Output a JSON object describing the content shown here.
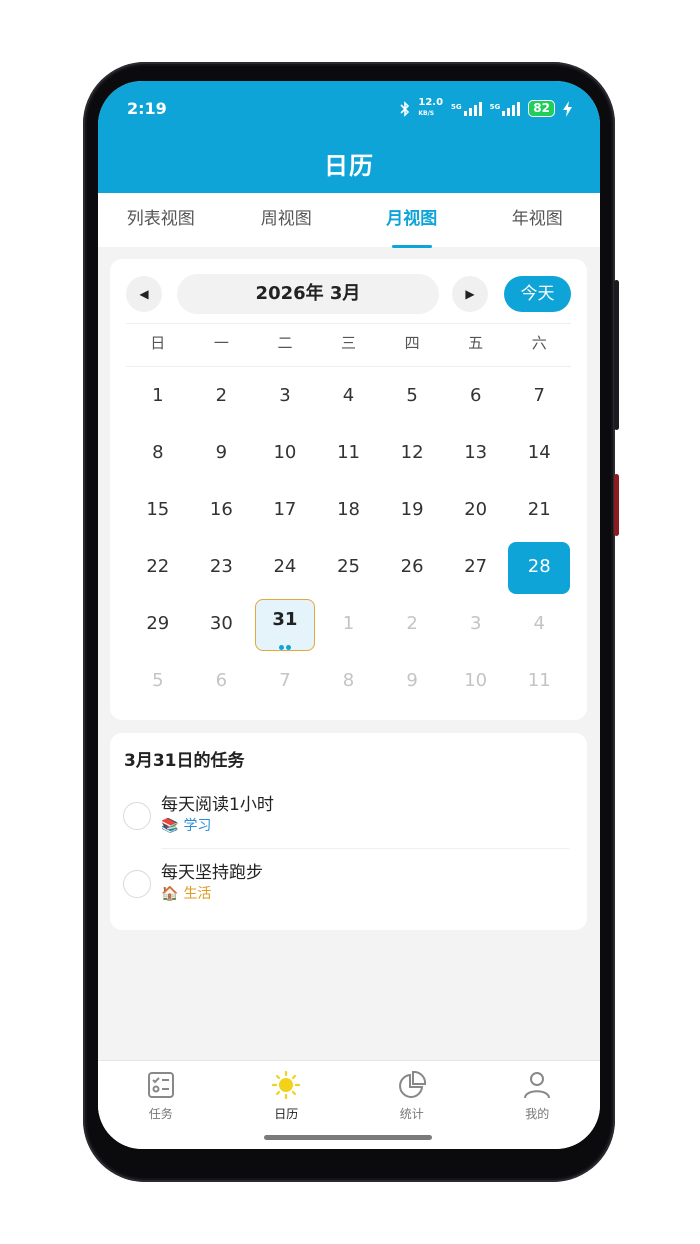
{
  "status_bar": {
    "time": "2:19",
    "net_speed_top": "12.0",
    "net_speed_unit": "KB/S",
    "sim1": "5G",
    "sim2": "5G",
    "battery": "82"
  },
  "header": {
    "title": "日历"
  },
  "tabs": [
    {
      "label": "列表视图",
      "active": false
    },
    {
      "label": "周视图",
      "active": false
    },
    {
      "label": "月视图",
      "active": true
    },
    {
      "label": "年视图",
      "active": false
    }
  ],
  "calendar": {
    "prev_icon": "◀",
    "next_icon": "▶",
    "month_label": "2026年 3月",
    "today_label": "今天",
    "weekdays": [
      "日",
      "一",
      "二",
      "三",
      "四",
      "五",
      "六"
    ],
    "weeks": [
      [
        {
          "d": "1"
        },
        {
          "d": "2"
        },
        {
          "d": "3"
        },
        {
          "d": "4"
        },
        {
          "d": "5"
        },
        {
          "d": "6"
        },
        {
          "d": "7"
        }
      ],
      [
        {
          "d": "8"
        },
        {
          "d": "9"
        },
        {
          "d": "10"
        },
        {
          "d": "11"
        },
        {
          "d": "12"
        },
        {
          "d": "13"
        },
        {
          "d": "14"
        }
      ],
      [
        {
          "d": "15"
        },
        {
          "d": "16"
        },
        {
          "d": "17"
        },
        {
          "d": "18"
        },
        {
          "d": "19"
        },
        {
          "d": "20"
        },
        {
          "d": "21"
        }
      ],
      [
        {
          "d": "22"
        },
        {
          "d": "23"
        },
        {
          "d": "24"
        },
        {
          "d": "25"
        },
        {
          "d": "26"
        },
        {
          "d": "27"
        },
        {
          "d": "28",
          "state": "selected"
        }
      ],
      [
        {
          "d": "29"
        },
        {
          "d": "30"
        },
        {
          "d": "31",
          "state": "today",
          "dots": 2
        },
        {
          "d": "1",
          "muted": true
        },
        {
          "d": "2",
          "muted": true
        },
        {
          "d": "3",
          "muted": true
        },
        {
          "d": "4",
          "muted": true
        }
      ],
      [
        {
          "d": "5",
          "muted": true
        },
        {
          "d": "6",
          "muted": true
        },
        {
          "d": "7",
          "muted": true
        },
        {
          "d": "8",
          "muted": true
        },
        {
          "d": "9",
          "muted": true
        },
        {
          "d": "10",
          "muted": true
        },
        {
          "d": "11",
          "muted": true
        }
      ]
    ],
    "colors": {
      "accent": "#0ea4d8",
      "today_border": "#e3a83a",
      "today_bg": "#e5f3fb"
    }
  },
  "tasks": {
    "heading": "3月31日的任务",
    "items": [
      {
        "title": "每天阅读1小时",
        "tag_icon": "📚",
        "tag": "学习",
        "tag_color": "#2a8fd8"
      },
      {
        "title": "每天坚持跑步",
        "tag_icon": "🏠",
        "tag": "生活",
        "tag_color": "#e09a20"
      }
    ]
  },
  "bottom_nav": [
    {
      "label": "任务",
      "icon": "checklist-icon",
      "active": false
    },
    {
      "label": "日历",
      "icon": "sun-icon",
      "active": true
    },
    {
      "label": "统计",
      "icon": "pie-chart-icon",
      "active": false
    },
    {
      "label": "我的",
      "icon": "person-icon",
      "active": false
    }
  ]
}
